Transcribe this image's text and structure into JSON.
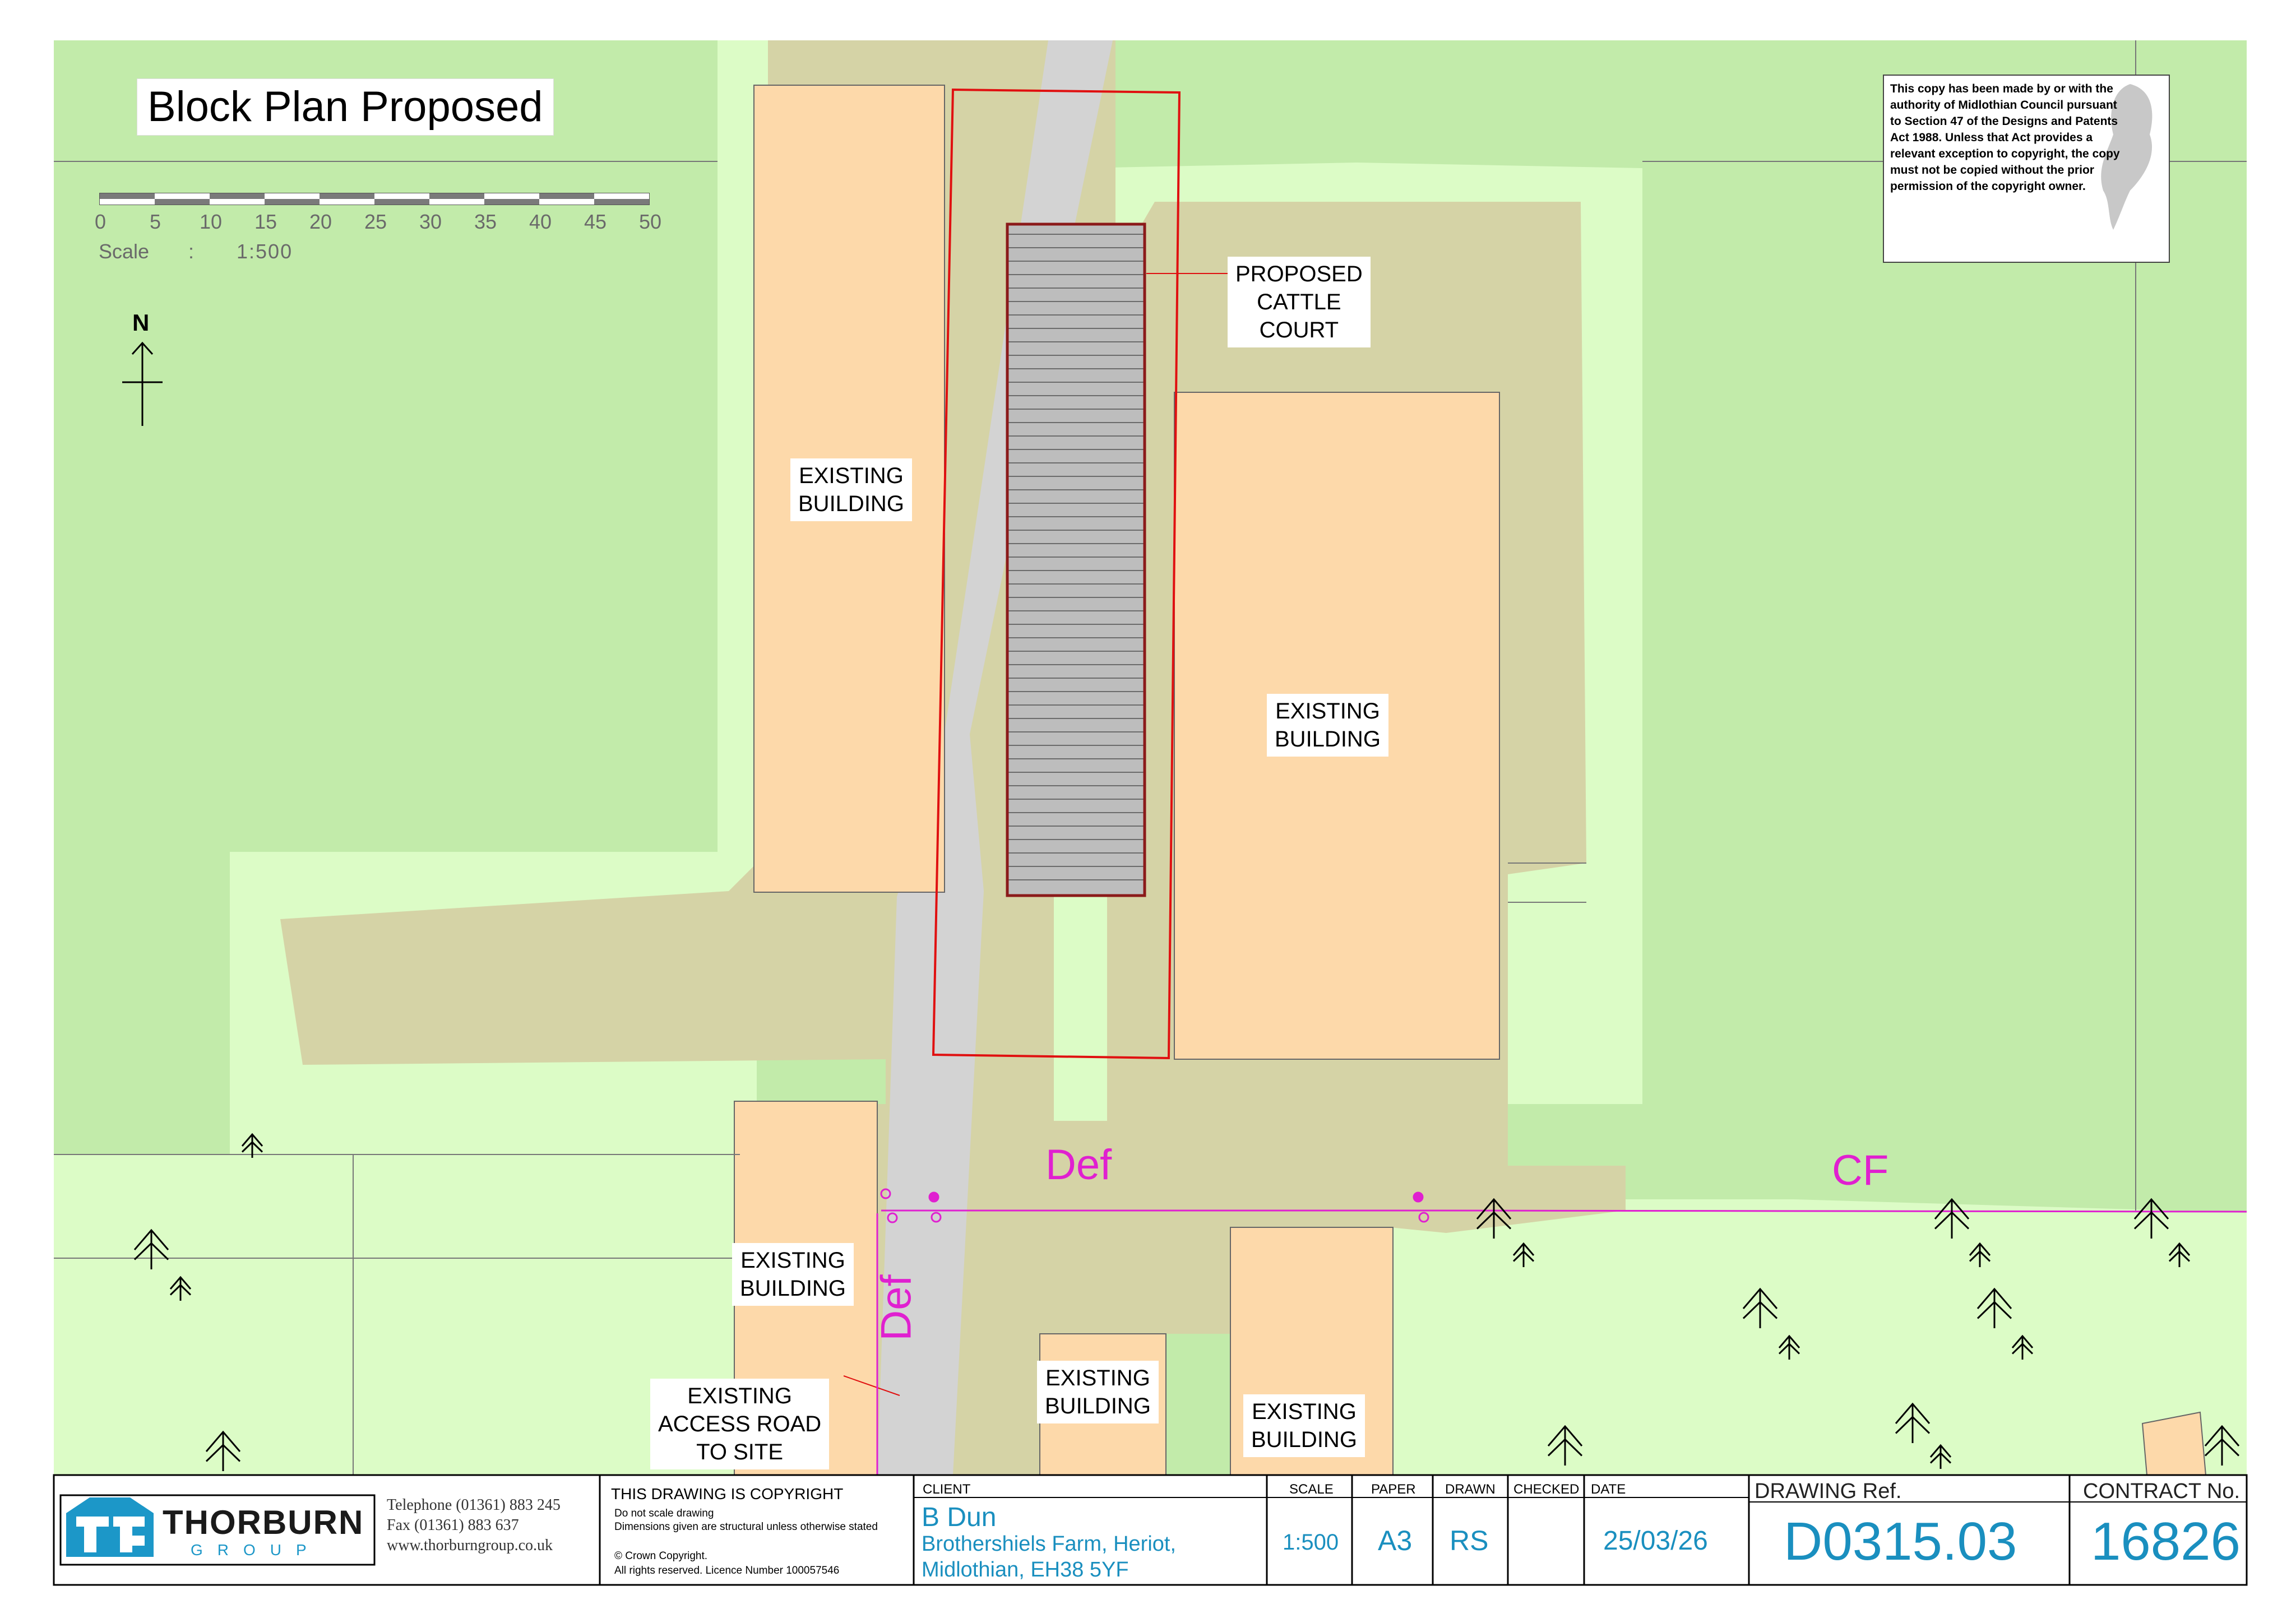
{
  "title": "Block Plan Proposed",
  "scale_bar": {
    "ticks": [
      "0",
      "5",
      "10",
      "15",
      "20",
      "25",
      "30",
      "35",
      "40",
      "45",
      "50"
    ],
    "scale_label": "Scale",
    "scale_sep": ":",
    "scale_value": "1:500"
  },
  "north_label": "N",
  "labels": {
    "proposed_cattle_court": [
      "PROPOSED",
      "CATTLE",
      "COURT"
    ],
    "existing_building": [
      "EXISTING",
      "BUILDING"
    ],
    "existing_access_road": [
      "EXISTING",
      "ACCESS ROAD",
      "TO SITE"
    ]
  },
  "boundary_labels": {
    "def_top": "Def",
    "def_vertical": "Def",
    "cf": "CF"
  },
  "copyright_notice": [
    "This copy has been made by or with the",
    "authority of Midlothian Council pursuant",
    "to Section 47 of the Designs and Patents",
    "Act 1988. Unless that Act provides a",
    "relevant exception to copyright, the copy",
    "must not be copied without the prior",
    "permission of the copyright owner."
  ],
  "title_block": {
    "company": "THORBURN",
    "company_sub": "GROUP",
    "telephone": "Telephone (01361) 883 245",
    "fax": "Fax (01361) 883 637",
    "web": "www.thorburngroup.co.uk",
    "copyright_heading": "THIS DRAWING IS COPYRIGHT",
    "note1": "Do not scale drawing",
    "note2": "Dimensions given are structural unless otherwise stated",
    "crown1": "© Crown Copyright.",
    "crown2": "All rights reserved. Licence Number 100057546",
    "client_heading": "CLIENT",
    "client_name": "B Dun",
    "client_address1": "Brothershiels Farm, Heriot,",
    "client_address2": "Midlothian, EH38 5YF",
    "scale_heading": "SCALE",
    "scale_value": "1:500",
    "paper_heading": "PAPER",
    "paper_value": "A3",
    "drawn_heading": "DRAWN",
    "drawn_value": "RS",
    "checked_heading": "CHECKED",
    "checked_value": "",
    "date_heading": "DATE",
    "date_value": "25/03/26",
    "drawing_ref_heading": "DRAWING Ref.",
    "drawing_ref_value": "D0315.03",
    "contract_heading": "CONTRACT No.",
    "contract_value": "16826"
  },
  "colors": {
    "field_dark": "#c2ebaa",
    "field_light": "#dcfcc6",
    "yard": "#d5d3a6",
    "building": "#fdd9aa",
    "road": "#d3d3d3",
    "red_line": "#e01010",
    "accent_text": "#1a8fbf",
    "magenta": "#e020d0"
  }
}
